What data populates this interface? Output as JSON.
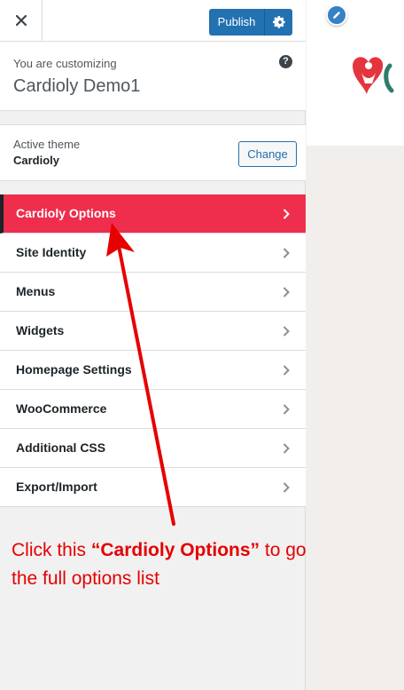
{
  "header": {
    "close_label": "×",
    "publish_label": "Publish"
  },
  "info": {
    "pre_title": "You are customizing",
    "site_title": "Cardioly Demo1",
    "help_label": "?"
  },
  "theme": {
    "label": "Active theme",
    "name": "Cardioly",
    "change_label": "Change"
  },
  "menu": [
    {
      "label": "Cardioly Options",
      "active": true
    },
    {
      "label": "Site Identity"
    },
    {
      "label": "Menus"
    },
    {
      "label": "Widgets"
    },
    {
      "label": "Homepage Settings"
    },
    {
      "label": "WooCommerce"
    },
    {
      "label": "Additional CSS"
    },
    {
      "label": "Export/Import"
    }
  ],
  "annotation": {
    "before": "Click this ",
    "highlight": "“Cardioly Options”",
    "after": " to go to the full options list"
  },
  "colors": {
    "accent": "#ef2d4d",
    "publish": "#2271b1",
    "annotation": "#e60000"
  },
  "icons": [
    "close-icon",
    "gear-icon",
    "help-icon",
    "chevron-right-icon",
    "pencil-icon"
  ]
}
